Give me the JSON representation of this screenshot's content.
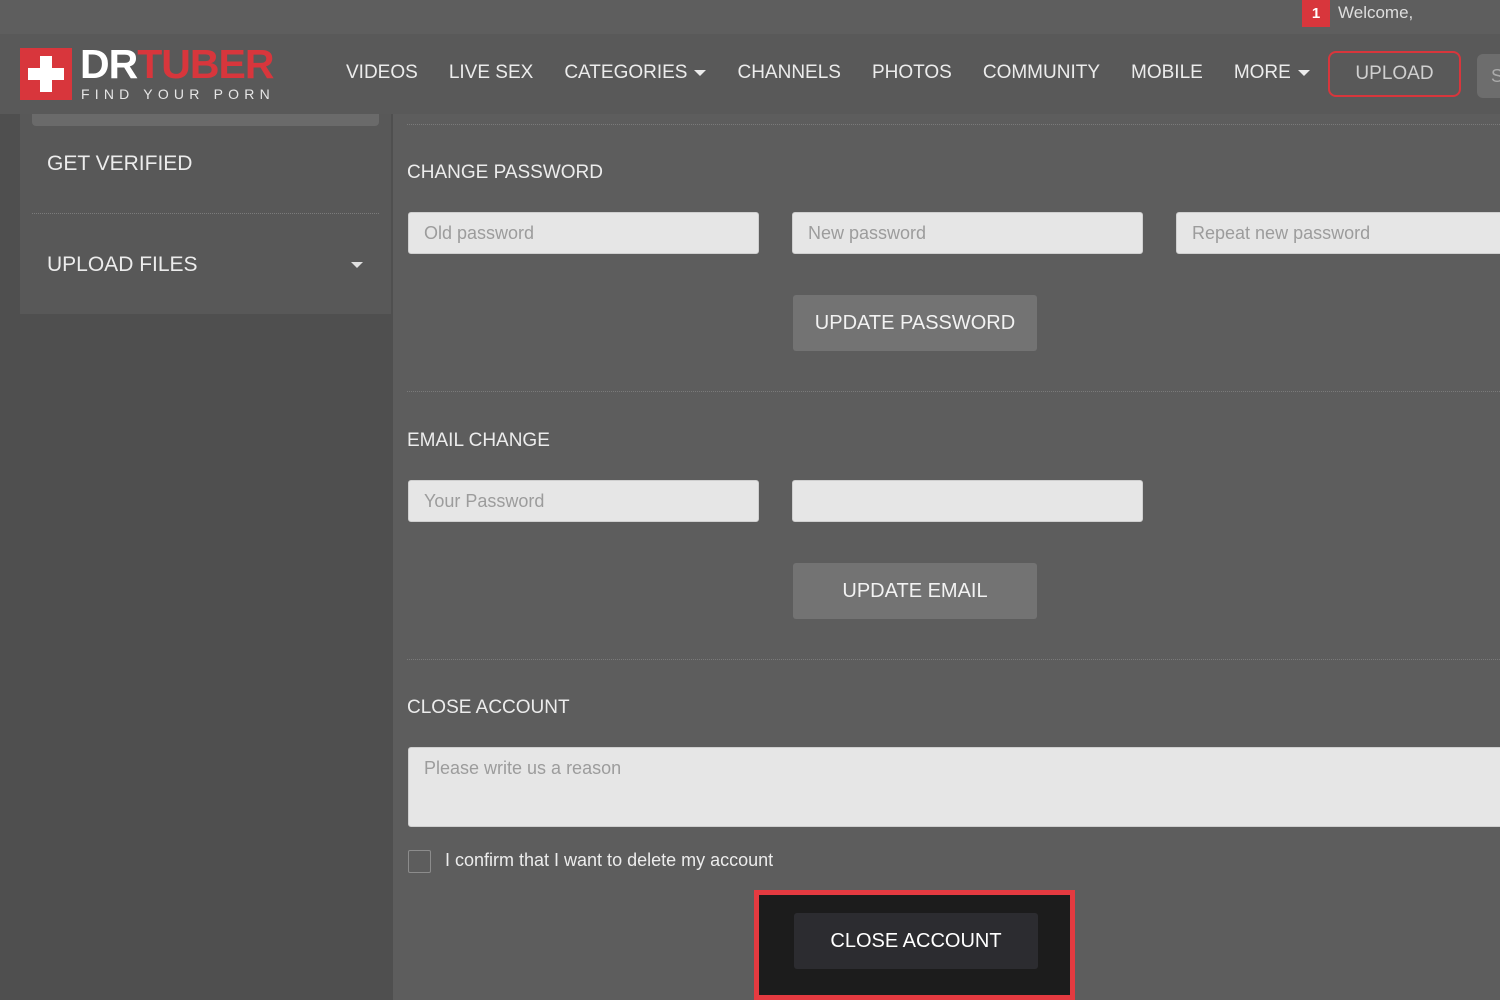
{
  "topbar": {
    "notification_count": "1",
    "welcome_text": "Welcome,"
  },
  "header": {
    "logo": {
      "brand_part1": "DR",
      "brand_part2": "TUBER",
      "tagline": "FIND YOUR PORN"
    },
    "nav": [
      {
        "label": "VIDEOS",
        "has_dropdown": false
      },
      {
        "label": "LIVE SEX",
        "has_dropdown": false
      },
      {
        "label": "CATEGORIES",
        "has_dropdown": true
      },
      {
        "label": "CHANNELS",
        "has_dropdown": false
      },
      {
        "label": "PHOTOS",
        "has_dropdown": false
      },
      {
        "label": "COMMUNITY",
        "has_dropdown": false
      },
      {
        "label": "MOBILE",
        "has_dropdown": false
      },
      {
        "label": "MORE",
        "has_dropdown": true
      }
    ],
    "upload_label": "UPLOAD",
    "edge_partial_text": "S"
  },
  "sidebar": {
    "items": [
      {
        "label": "GET VERIFIED"
      },
      {
        "label": "UPLOAD FILES"
      }
    ]
  },
  "main": {
    "change_password": {
      "title": "CHANGE PASSWORD",
      "old_placeholder": "Old password",
      "new_placeholder": "New password",
      "repeat_placeholder": "Repeat new password",
      "button_label": "UPDATE PASSWORD"
    },
    "email_change": {
      "title": "EMAIL CHANGE",
      "password_placeholder": "Your Password",
      "email_value": "",
      "button_label": "UPDATE EMAIL"
    },
    "close_account": {
      "title": "CLOSE ACCOUNT",
      "reason_placeholder": "Please write us a reason",
      "confirm_label": "I confirm that I want to delete my account",
      "button_label": "CLOSE ACCOUNT"
    }
  },
  "colors": {
    "brand_red": "#d8363c",
    "highlight_red": "#e43a40",
    "panel_gray": "#5d5d5d"
  }
}
